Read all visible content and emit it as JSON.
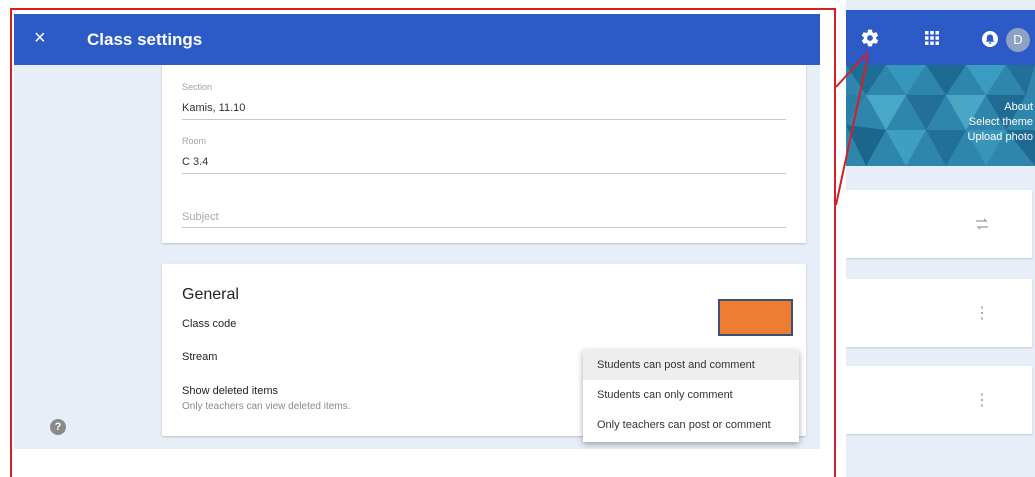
{
  "dialog": {
    "title": "Class settings",
    "close_icon": "×"
  },
  "class_details": {
    "section_label": "Section",
    "section_value": "Kamis, 11.10",
    "room_label": "Room",
    "room_value": "C 3.4",
    "subject_placeholder": "Subject"
  },
  "general": {
    "heading": "General",
    "class_code_label": "Class code",
    "stream_label": "Stream",
    "show_deleted_label": "Show deleted items",
    "show_deleted_desc": "Only teachers can view deleted items."
  },
  "stream_menu": {
    "options": [
      "Students can post and comment",
      "Students can only comment",
      "Only teachers can post or comment"
    ],
    "selected_index": 0
  },
  "help_icon": "?",
  "topbar": {
    "avatar_letter": "D"
  },
  "banner": {
    "links": [
      "About",
      "Select theme",
      "Upload photo"
    ]
  },
  "colors": {
    "app_blue": "#2c5bc7",
    "highlight_red": "#d51f26",
    "orange_box": "#ed7d31",
    "page_bg": "#e8eef8"
  }
}
